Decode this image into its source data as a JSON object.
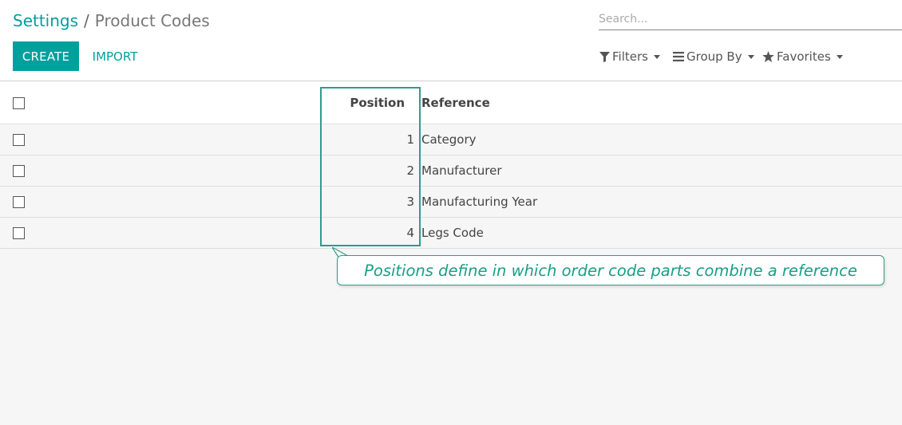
{
  "breadcrumb": {
    "parent": "Settings",
    "separator": "/",
    "current": "Product Codes"
  },
  "toolbar": {
    "create_label": "CREATE",
    "import_label": "IMPORT"
  },
  "search": {
    "placeholder": "Search..."
  },
  "filters": {
    "filters_label": "Filters",
    "group_by_label": "Group By",
    "favorites_label": "Favorites"
  },
  "table": {
    "columns": [
      "Position",
      "Reference"
    ],
    "rows": [
      {
        "position": "1",
        "reference": "Category"
      },
      {
        "position": "2",
        "reference": "Manufacturer"
      },
      {
        "position": "3",
        "reference": "Manufacturing Year"
      },
      {
        "position": "4",
        "reference": "Legs Code"
      }
    ]
  },
  "annotation": {
    "text": "Positions define in which order code parts combine a reference"
  },
  "colors": {
    "accent": "#00a09d",
    "annotation": "#16a085"
  }
}
